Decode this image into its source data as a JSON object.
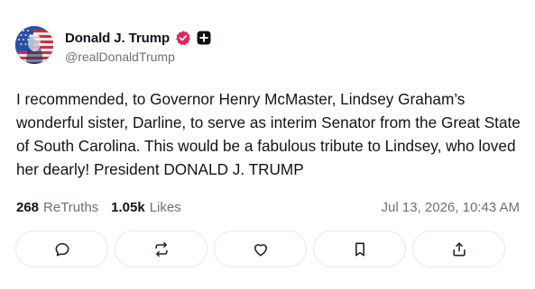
{
  "author": {
    "display_name": "Donald J. Trump",
    "handle": "@realDonaldTrump",
    "avatar_icon": "flag-portrait-avatar",
    "verified_icon": "verified-check-icon",
    "verified_color": "#e0245e",
    "badge_icon": "plus-badge-icon"
  },
  "post": {
    "text": "I recommended, to Governor Henry McMaster, Lindsey Graham’s wonderful sister, Darline, to serve as interim Senator from the Great State of South Carolina. This would be a fabulous tribute to Lindsey, who loved her dearly! President DONALD J. TRUMP"
  },
  "stats": {
    "retruths_count": "268",
    "retruths_label": "ReTruths",
    "likes_count": "1.05k",
    "likes_label": "Likes",
    "timestamp": "Jul 13, 2026, 10:43 AM"
  },
  "actions": [
    {
      "icon": "reply-icon"
    },
    {
      "icon": "retruth-icon"
    },
    {
      "icon": "like-icon"
    },
    {
      "icon": "bookmark-icon"
    },
    {
      "icon": "share-icon"
    }
  ],
  "colors": {
    "text": "#0f1419",
    "muted": "#6b6f76",
    "border": "#e6e8eb"
  }
}
